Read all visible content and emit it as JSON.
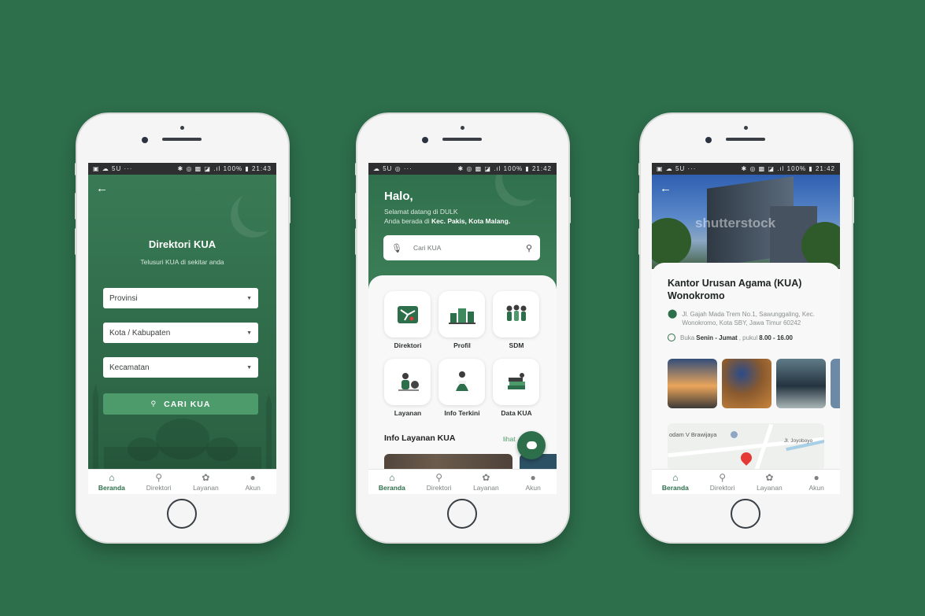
{
  "phone1": {
    "status": {
      "left": "▣ ☁ 5U  ···",
      "right": "✱ ◎ ▩ ◪ .ıl 100% ▮ 21:43"
    },
    "title": "Direktori KUA",
    "subtitle": "Telusuri KUA di sekitar anda",
    "selects": {
      "provinsi": "Provinsi",
      "kota": "Kota / Kabupaten",
      "kecamatan": "Kecamatan"
    },
    "search_button": "CARI KUA"
  },
  "phone2": {
    "status": {
      "left": "☁ 5U ◎  ···",
      "right": "✱ ◎ ▩ ◪ .ıl 100% ▮ 21:42"
    },
    "greeting": "Halo,",
    "welcome_line1": "Selamat datang di DULK",
    "welcome_prefix": "Anda berada di ",
    "welcome_location": "Kec. Pakis, Kota Malang.",
    "search_placeholder": "Cari KUA",
    "menu": [
      "Direktori",
      "Profil",
      "SDM",
      "Layanan",
      "Info Terkini",
      "Data KUA"
    ],
    "info_title": "Info Layanan KUA",
    "info_link": "lihat"
  },
  "phone3": {
    "status": {
      "left": "▣ ☁ 5U  ···",
      "right": "✱ ◎ ▩ ◪ .ıl 100% ▮ 21:42"
    },
    "watermark": "shutterstock",
    "title": "Kantor Urusan Agama (KUA) Wonokromo",
    "address": "Jl. Gajah Mada Trem No.1, Sawunggaling, Kec. Wonokromo, Kota SBY, Jawa Timur 60242",
    "hours_prefix": "Buka",
    "hours_days": "Senin - Jumat",
    "hours_mid": ", pukul",
    "hours_time": "8.00 - 16.00",
    "map_label1": "odam V Brawijaya",
    "map_label2": "Jl. Joyoboyo"
  },
  "nav": [
    "Beranda",
    "Direktori",
    "Layanan",
    "Akun"
  ],
  "colors": {
    "brand": "#2d6e4b",
    "accent": "#4d9a6a",
    "background": "#2d6e4b"
  }
}
